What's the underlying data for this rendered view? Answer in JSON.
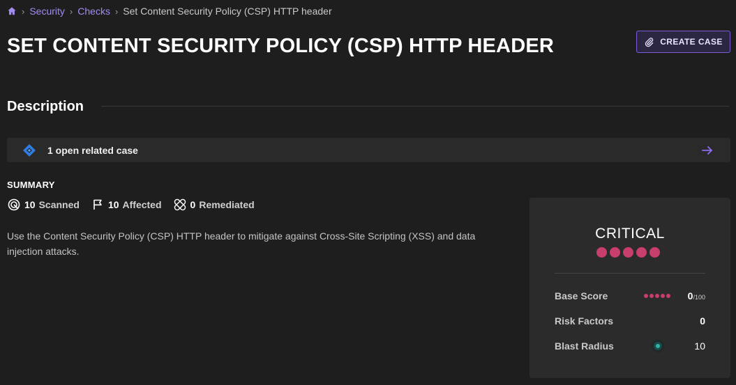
{
  "breadcrumb": {
    "items": [
      "Security",
      "Checks"
    ],
    "current": "Set Content Security Policy (CSP) HTTP header"
  },
  "page_title": "SET CONTENT SECURITY POLICY (CSP) HTTP HEADER",
  "create_case_label": "CREATE CASE",
  "description_heading": "Description",
  "related_case": {
    "label": "1 open related case"
  },
  "summary": {
    "label": "SUMMARY",
    "scanned": {
      "count": "10",
      "label": "Scanned"
    },
    "affected": {
      "count": "10",
      "label": "Affected"
    },
    "remediated": {
      "count": "0",
      "label": "Remediated"
    },
    "text": "Use the Content Security Policy (CSP) HTTP header to mitigate against Cross-Site Scripting (XSS) and data injection attacks."
  },
  "severity": {
    "label": "CRITICAL",
    "level_dots": 5,
    "color": "#c83e6c",
    "base_score": {
      "label": "Base Score",
      "value": "0",
      "max": "/100"
    },
    "risk_factors": {
      "label": "Risk Factors",
      "value": "0"
    },
    "blast_radius": {
      "label": "Blast Radius",
      "value": "10"
    }
  },
  "colors": {
    "accent": "#7b5cd6",
    "link": "#a38cf0",
    "background": "#1f1e1e",
    "card": "#2c2b2b",
    "critical": "#c83e6c",
    "blast": "#2ab5a8"
  },
  "icons": [
    "home-icon",
    "paperclip-icon",
    "jira-icon",
    "arrow-right-icon",
    "target-icon",
    "flag-icon",
    "bandage-icon",
    "blast-radius-icon"
  ]
}
